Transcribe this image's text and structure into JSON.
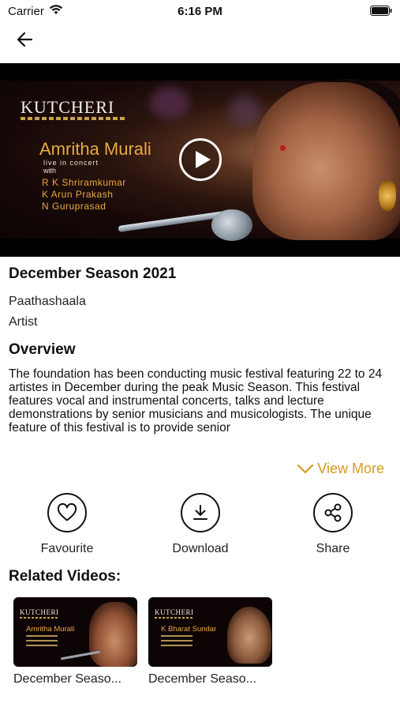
{
  "status_bar": {
    "carrier": "Carrier",
    "time": "6:16 PM"
  },
  "video": {
    "brand": "KUTCHERI",
    "artist": "Amritha Murali",
    "subtitle": "live in concert",
    "with_label": "with",
    "accompanists": [
      "R K Shriramkumar",
      "K Arun Prakash",
      "N Guruprasad"
    ]
  },
  "details": {
    "title": "December Season 2021",
    "category": "Paathashaala",
    "role": "Artist",
    "overview_heading": "Overview",
    "overview_text": "The foundation has been conducting music festival featuring 22 to 24 artistes in December during the peak Music Season. This festival features vocal and instrumental concerts, talks and lecture demonstrations by senior musicians and musicologists. The unique feature of this festival is to provide senior",
    "view_more": "View More"
  },
  "actions": {
    "favourite": "Favourite",
    "download": "Download",
    "share": "Share"
  },
  "related": {
    "heading": "Related Videos:",
    "items": [
      {
        "caption": "December Seaso...",
        "brand": "KUTCHERI",
        "artist": "Amritha Murali"
      },
      {
        "caption": "December Seaso...",
        "brand": "KUTCHERI",
        "artist": "K Bharat Sundar"
      }
    ]
  },
  "colors": {
    "accent": "#d89a1c",
    "promo_gold": "#e7a93f"
  }
}
